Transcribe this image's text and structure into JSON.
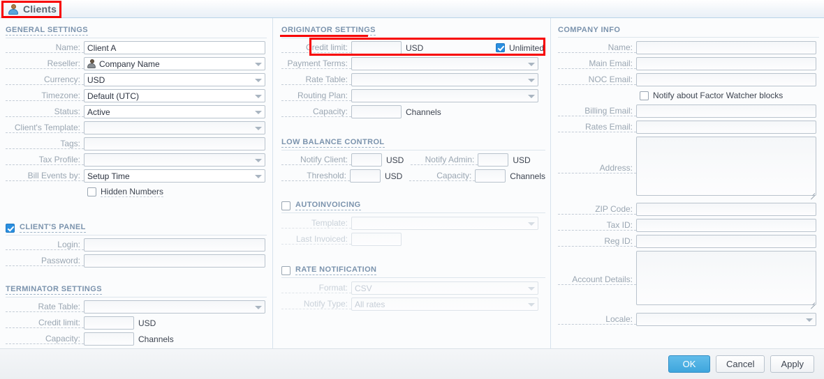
{
  "tab": {
    "label": "Clients",
    "icon": "user-icon"
  },
  "colors": {
    "accent": "#2a8fe0",
    "section_header": "#7b93ad",
    "label": "#9aa6b2",
    "annotation_red": "#f70000",
    "primary_button": "#3ea6dd"
  },
  "general_settings": {
    "title": "GENERAL SETTINGS",
    "rows": [
      {
        "label": "Name:",
        "type": "text",
        "value": "Client A"
      },
      {
        "label": "Reseller:",
        "type": "select",
        "value": "Company Name",
        "icon": "user-icon"
      },
      {
        "label": "Currency:",
        "type": "select",
        "value": "USD"
      },
      {
        "label": "Timezone:",
        "type": "select",
        "value": "Default (UTC)"
      },
      {
        "label": "Status:",
        "type": "select",
        "value": "Active"
      },
      {
        "label": "Client's Template:",
        "type": "select",
        "value": ""
      },
      {
        "label": "Tags:",
        "type": "text",
        "value": ""
      },
      {
        "label": "Tax Profile:",
        "type": "select",
        "value": ""
      },
      {
        "label": "Bill Events by:",
        "type": "select",
        "value": "Setup Time"
      }
    ],
    "hidden_numbers": {
      "label": "Hidden Numbers",
      "checked": false
    }
  },
  "clients_panel": {
    "title": "CLIENT'S PANEL",
    "checked": true,
    "rows": [
      {
        "label": "Login:",
        "value": ""
      },
      {
        "label": "Password:",
        "value": ""
      }
    ]
  },
  "terminator_settings": {
    "title": "TERMINATOR SETTINGS",
    "rate_table": {
      "label": "Rate Table:",
      "value": ""
    },
    "credit_limit": {
      "label": "Credit limit:",
      "value": "",
      "unit": "USD"
    },
    "capacity": {
      "label": "Capacity:",
      "value": "",
      "unit": "Channels"
    }
  },
  "originator_settings": {
    "title": "ORIGINATOR SETTINGS",
    "credit_limit": {
      "label": "Credit limit:",
      "value": "",
      "unit": "USD",
      "unlimited_label": "Unlimited",
      "unlimited_checked": true
    },
    "rows": [
      {
        "label": "Payment Terms:",
        "value": ""
      },
      {
        "label": "Rate Table:",
        "value": ""
      },
      {
        "label": "Routing Plan:",
        "value": ""
      }
    ],
    "capacity": {
      "label": "Capacity:",
      "value": "",
      "unit": "Channels"
    }
  },
  "low_balance_control": {
    "title": "LOW BALANCE CONTROL",
    "notify_client": {
      "label": "Notify Client:",
      "value": "",
      "unit": "USD"
    },
    "notify_admin": {
      "label": "Notify Admin:",
      "value": "",
      "unit": "USD"
    },
    "threshold": {
      "label": "Threshold:",
      "value": "",
      "unit": "USD"
    },
    "capacity": {
      "label": "Capacity:",
      "value": "",
      "unit": "Channels"
    }
  },
  "autoinvoicing": {
    "title": "AUTOINVOICING",
    "checked": false,
    "template": {
      "label": "Template:",
      "value": ""
    },
    "last_invoiced": {
      "label": "Last Invoiced:",
      "value": ""
    }
  },
  "rate_notification": {
    "title": "RATE NOTIFICATION",
    "checked": false,
    "format": {
      "label": "Format:",
      "value": "CSV"
    },
    "notify_type": {
      "label": "Notify Type:",
      "value": "All rates"
    }
  },
  "company_info": {
    "title": "COMPANY INFO",
    "name": {
      "label": "Name:",
      "value": ""
    },
    "main_email": {
      "label": "Main Email:",
      "value": ""
    },
    "noc_email": {
      "label": "NOC Email:",
      "value": ""
    },
    "factor_watcher": {
      "label": "Notify about Factor Watcher blocks",
      "checked": false
    },
    "billing_email": {
      "label": "Billing Email:",
      "value": ""
    },
    "rates_email": {
      "label": "Rates Email:",
      "value": ""
    },
    "address": {
      "label": "Address:",
      "value": ""
    },
    "zip_code": {
      "label": "ZIP Code:",
      "value": ""
    },
    "tax_id": {
      "label": "Tax ID:",
      "value": ""
    },
    "reg_id": {
      "label": "Reg ID:",
      "value": ""
    },
    "account_details": {
      "label": "Account Details:",
      "value": ""
    },
    "locale": {
      "label": "Locale:",
      "value": ""
    }
  },
  "footer": {
    "ok": "OK",
    "cancel": "Cancel",
    "apply": "Apply"
  }
}
